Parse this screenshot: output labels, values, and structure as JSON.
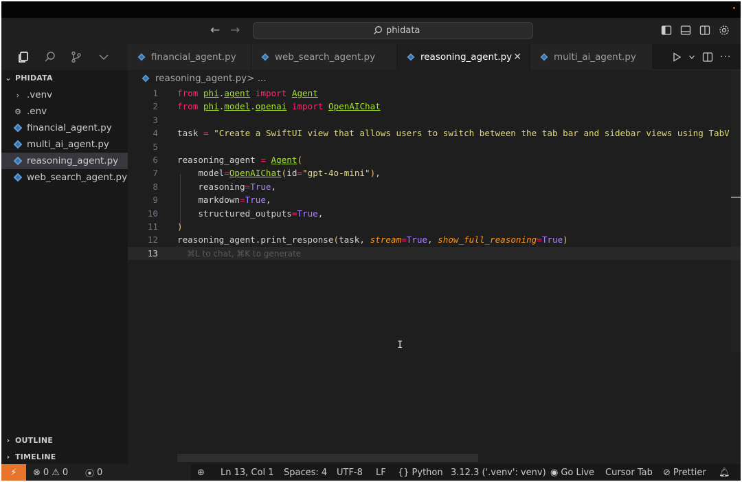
{
  "window": {
    "command_center_text": "phidata"
  },
  "tabs": [
    {
      "label": "financial_agent.py",
      "active": false
    },
    {
      "label": "web_search_agent.py",
      "active": false
    },
    {
      "label": "reasoning_agent.py",
      "active": true,
      "close_glyph": "✕"
    },
    {
      "label": "multi_ai_agent.py",
      "active": false
    }
  ],
  "tab_actions": {
    "more_glyph": "···"
  },
  "sidebar": {
    "explorer_title": "PHIDATA",
    "items": [
      {
        "label": ".venv",
        "icon": "chevron-right-icon",
        "selected": false
      },
      {
        "label": ".env",
        "icon": "gear-icon",
        "selected": false
      },
      {
        "label": "financial_agent.py",
        "icon": "python-icon",
        "selected": false
      },
      {
        "label": "multi_ai_agent.py",
        "icon": "python-icon",
        "selected": false
      },
      {
        "label": "reasoning_agent.py",
        "icon": "python-icon",
        "selected": true
      },
      {
        "label": "web_search_agent.py",
        "icon": "python-icon",
        "selected": false
      }
    ],
    "outline_title": "OUTLINE",
    "timeline_title": "TIMELINE"
  },
  "editor": {
    "breadcrumb_file": "reasoning_agent.py",
    "breadcrumb_rest": " > ...",
    "line_numbers": [
      "1",
      "2",
      "3",
      "4",
      "5",
      "6",
      "7",
      "8",
      "9",
      "10",
      "11",
      "12",
      "13"
    ],
    "line4_task": "task",
    "line4_string": "\"Create a SwiftUI view that allows users to switch between the tab bar and sidebar views using TabV",
    "line7_model_id": "\"gpt-4o-mini\"",
    "line13_hint": "⌘L to chat, ⌘K to generate"
  },
  "statusbar": {
    "errors": "0",
    "warnings": "0",
    "ports": "0",
    "position": "Ln 13, Col 1",
    "spaces": "Spaces: 4",
    "encoding": "UTF-8",
    "eol": "LF",
    "language": "Python",
    "interpreter": "3.12.3 ('.venv': venv)",
    "go_live": "Go Live",
    "cursor_tab": "Cursor Tab",
    "prettier": "Prettier"
  },
  "colors": {
    "accent_remote": "#e8742c",
    "keyword": "#f92672",
    "module": "#a6e22e",
    "string": "#e6db74",
    "boolean": "#ae81ff"
  }
}
